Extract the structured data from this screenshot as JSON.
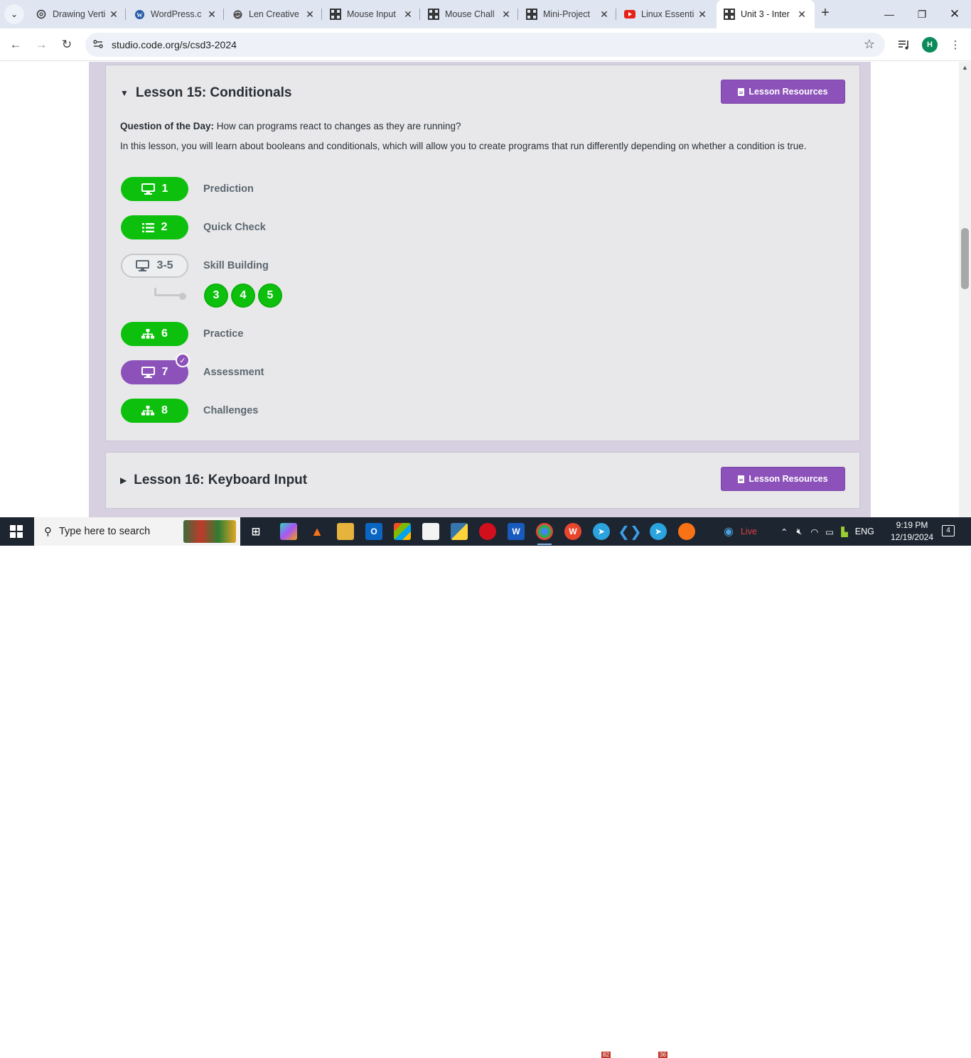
{
  "browser": {
    "tabs": [
      {
        "title": "Drawing Verti",
        "icon": "chatgpt-icon",
        "active": false
      },
      {
        "title": "WordPress.c",
        "icon": "wordpress-icon",
        "active": false
      },
      {
        "title": "Len Creative",
        "icon": "globe-icon",
        "active": false
      },
      {
        "title": "Mouse Input",
        "icon": "code-org-icon",
        "active": false
      },
      {
        "title": "Mouse Chall",
        "icon": "code-org-icon",
        "active": false
      },
      {
        "title": "Mini-Project",
        "icon": "code-org-icon",
        "active": false
      },
      {
        "title": "Linux Essenti",
        "icon": "youtube-icon",
        "active": false
      },
      {
        "title": "Unit 3 - Inter",
        "icon": "code-org-icon",
        "active": true
      }
    ],
    "url": "studio.code.org/s/csd3-2024",
    "profile_initial": "H"
  },
  "lesson15": {
    "title": "Lesson 15: Conditionals",
    "resources_label": "Lesson Resources",
    "question_label": "Question of the Day:",
    "question_text": "How can programs react to changes as they are running?",
    "description": "In this lesson, you will learn about booleans and conditionals, which will allow you to create programs that run differently depending on whether a condition is true.",
    "levels": [
      {
        "number": "1",
        "label": "Prediction",
        "icon": "monitor-icon",
        "state": "complete"
      },
      {
        "number": "2",
        "label": "Quick Check",
        "icon": "list-icon",
        "state": "complete"
      },
      {
        "number": "3-5",
        "label": "Skill Building",
        "icon": "monitor-icon",
        "state": "not-started"
      },
      {
        "number": "6",
        "label": "Practice",
        "icon": "sitemap-icon",
        "state": "complete"
      },
      {
        "number": "7",
        "label": "Assessment",
        "icon": "monitor-icon",
        "state": "submitted"
      },
      {
        "number": "8",
        "label": "Challenges",
        "icon": "sitemap-icon",
        "state": "complete"
      }
    ],
    "sublevels": [
      "3",
      "4",
      "5"
    ]
  },
  "lesson16": {
    "title": "Lesson 16: Keyboard Input",
    "resources_label": "Lesson Resources"
  },
  "taskbar": {
    "search_placeholder": "Type here to search",
    "live_label": "Live",
    "language": "ENG",
    "time": "9:19 PM",
    "date": "12/19/2024",
    "notification_count": "4",
    "telegram_badge_1": "82",
    "telegram_badge_2": "36"
  },
  "colors": {
    "complete": "#0ec00e",
    "submitted": "#8c52ba",
    "not_started": "#c8c8c8"
  }
}
